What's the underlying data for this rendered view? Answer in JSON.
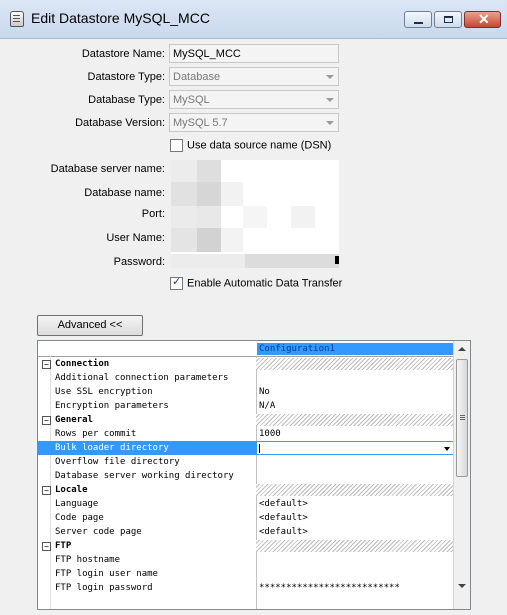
{
  "window": {
    "title": "Edit Datastore MySQL_MCC"
  },
  "form": {
    "datastore_name": {
      "label": "Datastore Name:",
      "value": "MySQL_MCC"
    },
    "datastore_type": {
      "label": "Datastore Type:",
      "value": "Database"
    },
    "database_type": {
      "label": "Database Type:",
      "value": "MySQL"
    },
    "database_version": {
      "label": "Database Version:",
      "value": "MySQL 5.7"
    },
    "use_dsn": {
      "label": "Use data source name (DSN)",
      "checked": false
    },
    "server_name": {
      "label": "Database server name:"
    },
    "database_name": {
      "label": "Database name:"
    },
    "port": {
      "label": "Port:"
    },
    "user_name": {
      "label": "User Name:"
    },
    "password": {
      "label": "Password:"
    },
    "enable_transfer": {
      "label": "Enable Automatic Data Transfer",
      "checked": true
    }
  },
  "advanced_button": "Advanced <<",
  "grid": {
    "column_header": "Configuration1",
    "rows": [
      {
        "type": "cat",
        "name": "Connection",
        "expander": "−"
      },
      {
        "type": "prop",
        "name": "Additional connection parameters",
        "value": ""
      },
      {
        "type": "prop",
        "name": "Use SSL encryption",
        "value": "No"
      },
      {
        "type": "prop",
        "name": "Encryption parameters",
        "value": "N/A"
      },
      {
        "type": "cat",
        "name": "General",
        "expander": "−"
      },
      {
        "type": "prop",
        "name": "Rows per commit",
        "value": "1000"
      },
      {
        "type": "prop",
        "name": "Bulk loader directory",
        "value": "",
        "selected": true
      },
      {
        "type": "prop",
        "name": "Overflow file directory",
        "value": ""
      },
      {
        "type": "prop",
        "name": "Database server working directory",
        "value": ""
      },
      {
        "type": "cat",
        "name": "Locale",
        "expander": "−"
      },
      {
        "type": "prop",
        "name": "Language",
        "value": "<default>"
      },
      {
        "type": "prop",
        "name": "Code page",
        "value": "<default>"
      },
      {
        "type": "prop",
        "name": "Server code page",
        "value": "<default>"
      },
      {
        "type": "cat",
        "name": "FTP",
        "expander": "−"
      },
      {
        "type": "prop",
        "name": "FTP hostname",
        "value": ""
      },
      {
        "type": "prop",
        "name": "FTP login user name",
        "value": ""
      },
      {
        "type": "prop",
        "name": "FTP login password",
        "value": "**************************"
      }
    ]
  }
}
